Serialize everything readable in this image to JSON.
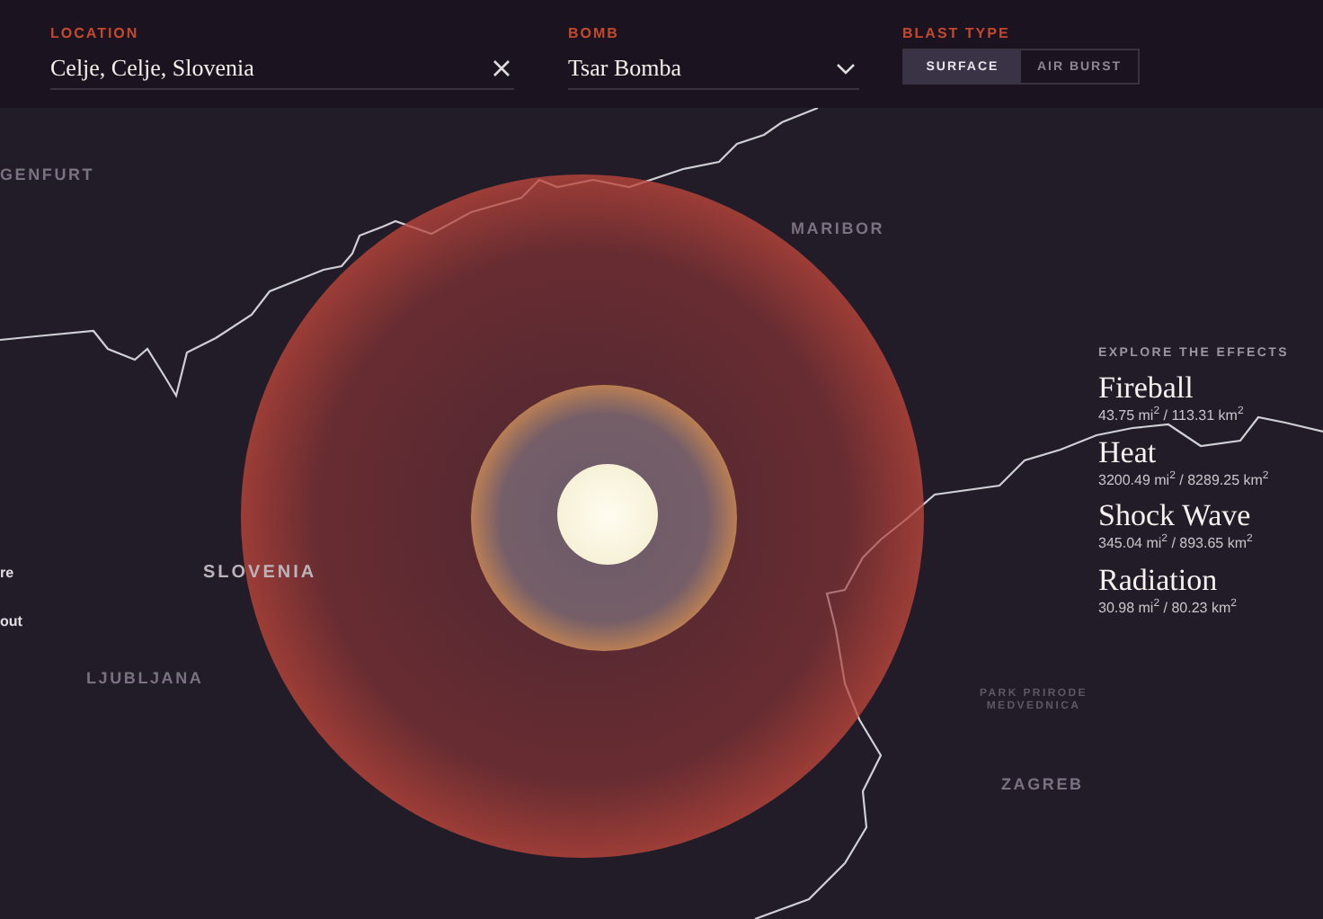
{
  "controls": {
    "location": {
      "label": "LOCATION",
      "value": "Celje, Celje, Slovenia"
    },
    "bomb": {
      "label": "BOMB",
      "value": "Tsar Bomba"
    },
    "blast_type": {
      "label": "BLAST TYPE",
      "options": [
        {
          "label": "SURFACE",
          "selected": true
        },
        {
          "label": "AIR BURST",
          "selected": false
        }
      ]
    }
  },
  "map": {
    "labels": [
      {
        "text": "GENFURT",
        "kind": "city"
      },
      {
        "text": "MARIBOR",
        "kind": "city"
      },
      {
        "text": "SLOVENIA",
        "kind": "country"
      },
      {
        "text": "LJUBLJANA",
        "kind": "city"
      },
      {
        "text": "ZAGREB",
        "kind": "city"
      },
      {
        "text": "PARK PRIRODE\nMEDVEDNICA",
        "kind": "park"
      },
      {
        "text": "re",
        "kind": "edge"
      },
      {
        "text": "out",
        "kind": "edge"
      }
    ]
  },
  "effects": {
    "title": "EXPLORE THE EFFECTS",
    "items": [
      {
        "name": "Fireball",
        "reading": "43.75 mi$^{2}$ / 113.31 km$^{2}$"
      },
      {
        "name": "Heat",
        "reading": "3200.49 mi$^{2}$ / 8289.25 km$^{2}$"
      },
      {
        "name": "Shock Wave",
        "reading": "345.04 mi$^{2}$ / 893.65 km$^{2}$"
      },
      {
        "name": "Radiation",
        "reading": "30.98 mi$^{2}$ / 80.23 km$^{2}$"
      }
    ]
  }
}
